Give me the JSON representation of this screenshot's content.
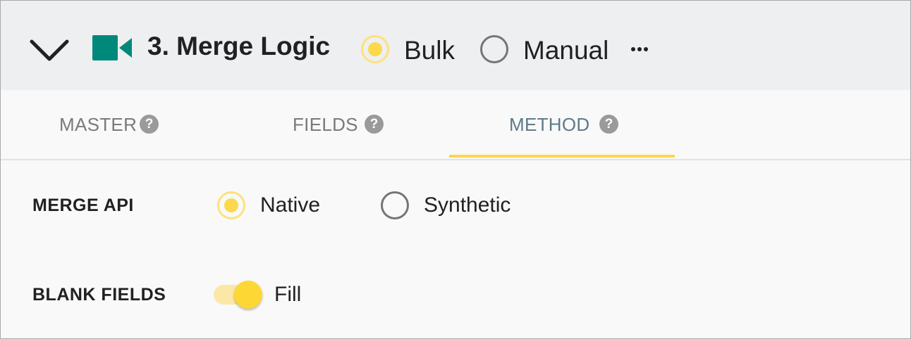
{
  "header": {
    "title": "3. Merge Logic",
    "collapse_icon": "chevron-down-icon",
    "section_icon": "video-camera-icon",
    "accent_color": "#00897b",
    "mode_options": [
      {
        "label": "Bulk",
        "selected": true
      },
      {
        "label": "Manual",
        "selected": false
      }
    ],
    "more_icon": "more-horizontal-icon"
  },
  "tabs": [
    {
      "label": "MASTER",
      "help": "?",
      "active": false
    },
    {
      "label": "FIELDS",
      "help": "?",
      "active": false
    },
    {
      "label": "METHOD",
      "help": "?",
      "active": true
    }
  ],
  "form": {
    "merge_api": {
      "label": "MERGE API",
      "options": [
        {
          "label": "Native",
          "selected": true
        },
        {
          "label": "Synthetic",
          "selected": false
        }
      ]
    },
    "blank_fields": {
      "label": "BLANK FIELDS",
      "toggle_on": true,
      "toggle_label": "Fill"
    }
  },
  "colors": {
    "highlight": "#fdd835",
    "tab_active_text": "#5e7a88"
  }
}
